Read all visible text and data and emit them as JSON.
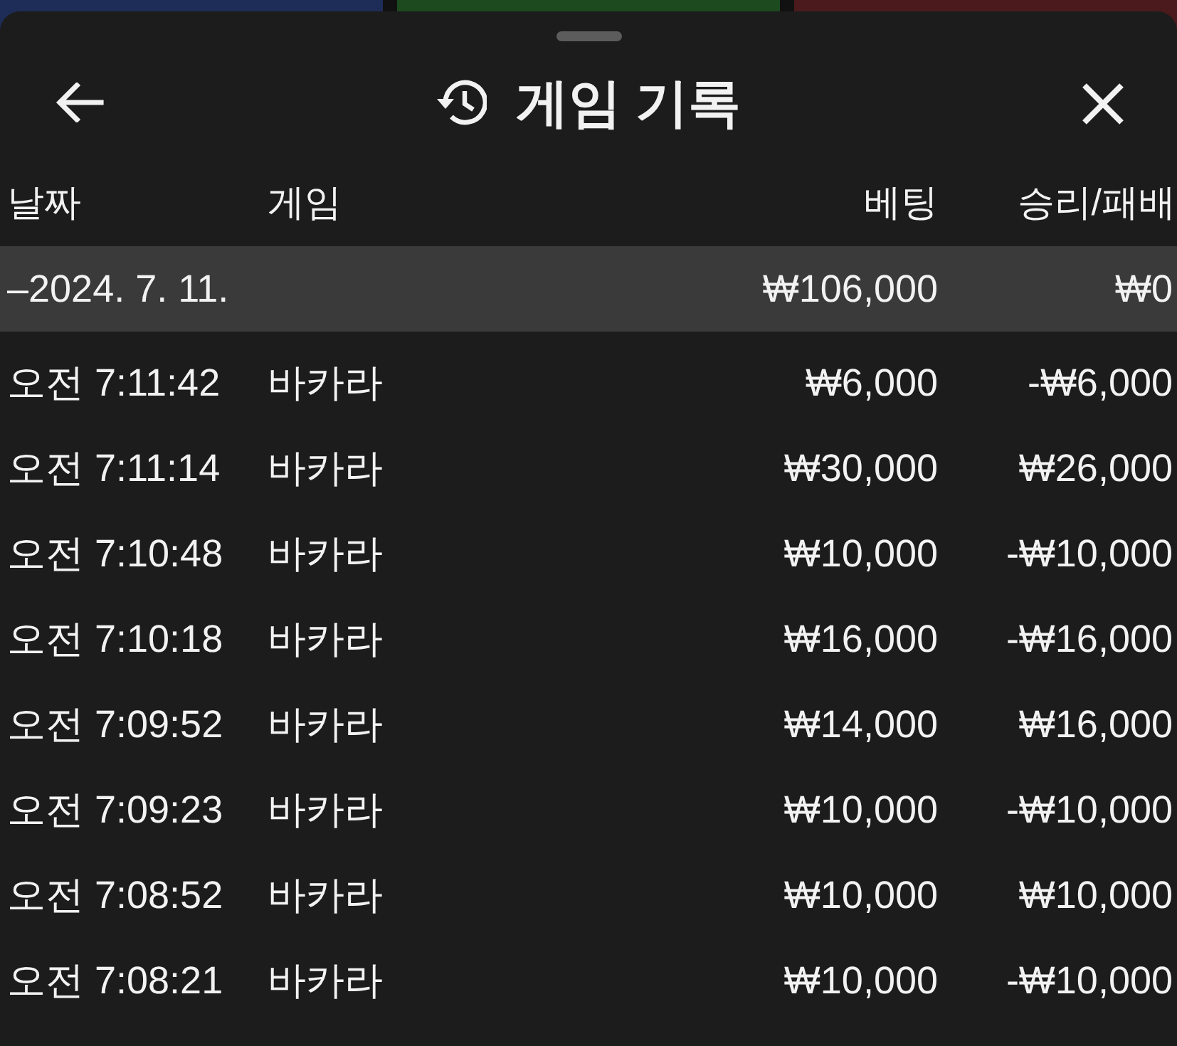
{
  "background_panels": [
    {
      "color": "#1d2d57"
    },
    {
      "color": "#1d4a1f"
    },
    {
      "color": "#4a1a1c"
    }
  ],
  "sheet": {
    "title": "게임 기록"
  },
  "table": {
    "columns": [
      "날짜",
      "게임",
      "베팅",
      "승리/패배"
    ],
    "summary": {
      "date": "–2024. 7. 11.",
      "bet": "₩106,000",
      "result": "₩0"
    },
    "rows": [
      {
        "time": "오전 7:11:42",
        "game": "바카라",
        "bet": "₩6,000",
        "result": "-₩6,000"
      },
      {
        "time": "오전 7:11:14",
        "game": "바카라",
        "bet": "₩30,000",
        "result": "₩26,000"
      },
      {
        "time": "오전 7:10:48",
        "game": "바카라",
        "bet": "₩10,000",
        "result": "-₩10,000"
      },
      {
        "time": "오전 7:10:18",
        "game": "바카라",
        "bet": "₩16,000",
        "result": "-₩16,000"
      },
      {
        "time": "오전 7:09:52",
        "game": "바카라",
        "bet": "₩14,000",
        "result": "₩16,000"
      },
      {
        "time": "오전 7:09:23",
        "game": "바카라",
        "bet": "₩10,000",
        "result": "-₩10,000"
      },
      {
        "time": "오전 7:08:52",
        "game": "바카라",
        "bet": "₩10,000",
        "result": "₩10,000"
      },
      {
        "time": "오전 7:08:21",
        "game": "바카라",
        "bet": "₩10,000",
        "result": "-₩10,000"
      }
    ]
  }
}
